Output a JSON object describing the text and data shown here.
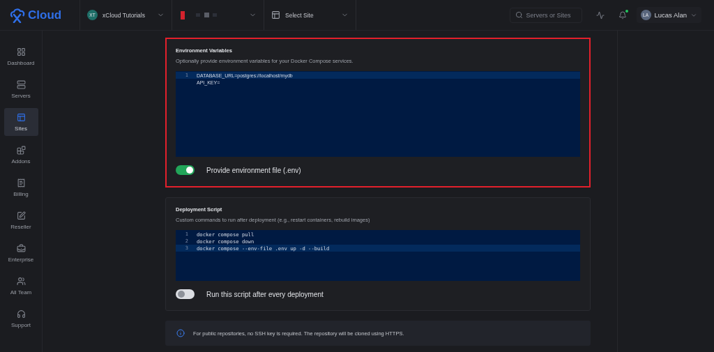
{
  "topbar": {
    "logo": "Cloud",
    "breadcrumbs": [
      {
        "kind": "team",
        "avatar": "XT",
        "label": "xCloud Tutorials"
      },
      {
        "kind": "redacted"
      },
      {
        "kind": "site",
        "label": "Select Site"
      }
    ],
    "search": {
      "placeholder": "Servers or Sites"
    },
    "notifications": {
      "unread": true
    },
    "user": {
      "avatar": "LA",
      "name": "Lucas Alan"
    }
  },
  "sidebar": {
    "items": [
      {
        "label": "Dashboard",
        "selected": false
      },
      {
        "label": "Servers",
        "selected": false
      },
      {
        "label": "Sites",
        "selected": true
      },
      {
        "label": "Addons",
        "selected": false
      },
      {
        "label": "Billing",
        "selected": false
      },
      {
        "label": "Reseller",
        "selected": false
      },
      {
        "label": "Enterprise",
        "selected": false
      },
      {
        "label": "All Team",
        "selected": false
      },
      {
        "label": "Support",
        "selected": false
      }
    ]
  },
  "sections": [
    {
      "kind": "env",
      "title": "Environment Variables",
      "description": "Optionally provide environment variables for your Docker Compose services.",
      "highlighted": true,
      "editor": {
        "lines": [
          {
            "number": "1",
            "text": "DATABASE_URL=postgres://localhost/mydb",
            "active": true
          },
          {
            "text": "API_KEY=",
            "active": false
          }
        ]
      },
      "toggle": {
        "label": "Provide environment file (.env)",
        "on": true
      }
    },
    {
      "kind": "script",
      "title": "Deployment Script",
      "description": "Custom commands to run after deployment (e.g., restart containers, rebuild images)",
      "highlighted": false,
      "editor": {
        "lines": [
          {
            "number": "1",
            "text": "docker compose pull",
            "active": false
          },
          {
            "number": "2",
            "text": "docker compose down",
            "active": false
          },
          {
            "number": "3",
            "text": "docker compose --env-file .env up -d --build",
            "active": true
          }
        ]
      },
      "toggle": {
        "label": "Run this script after every deployment",
        "on": false
      }
    }
  ],
  "notice": {
    "text": "For public repositories, no SSH key is required. The repository will be cloned using HTTPS."
  }
}
